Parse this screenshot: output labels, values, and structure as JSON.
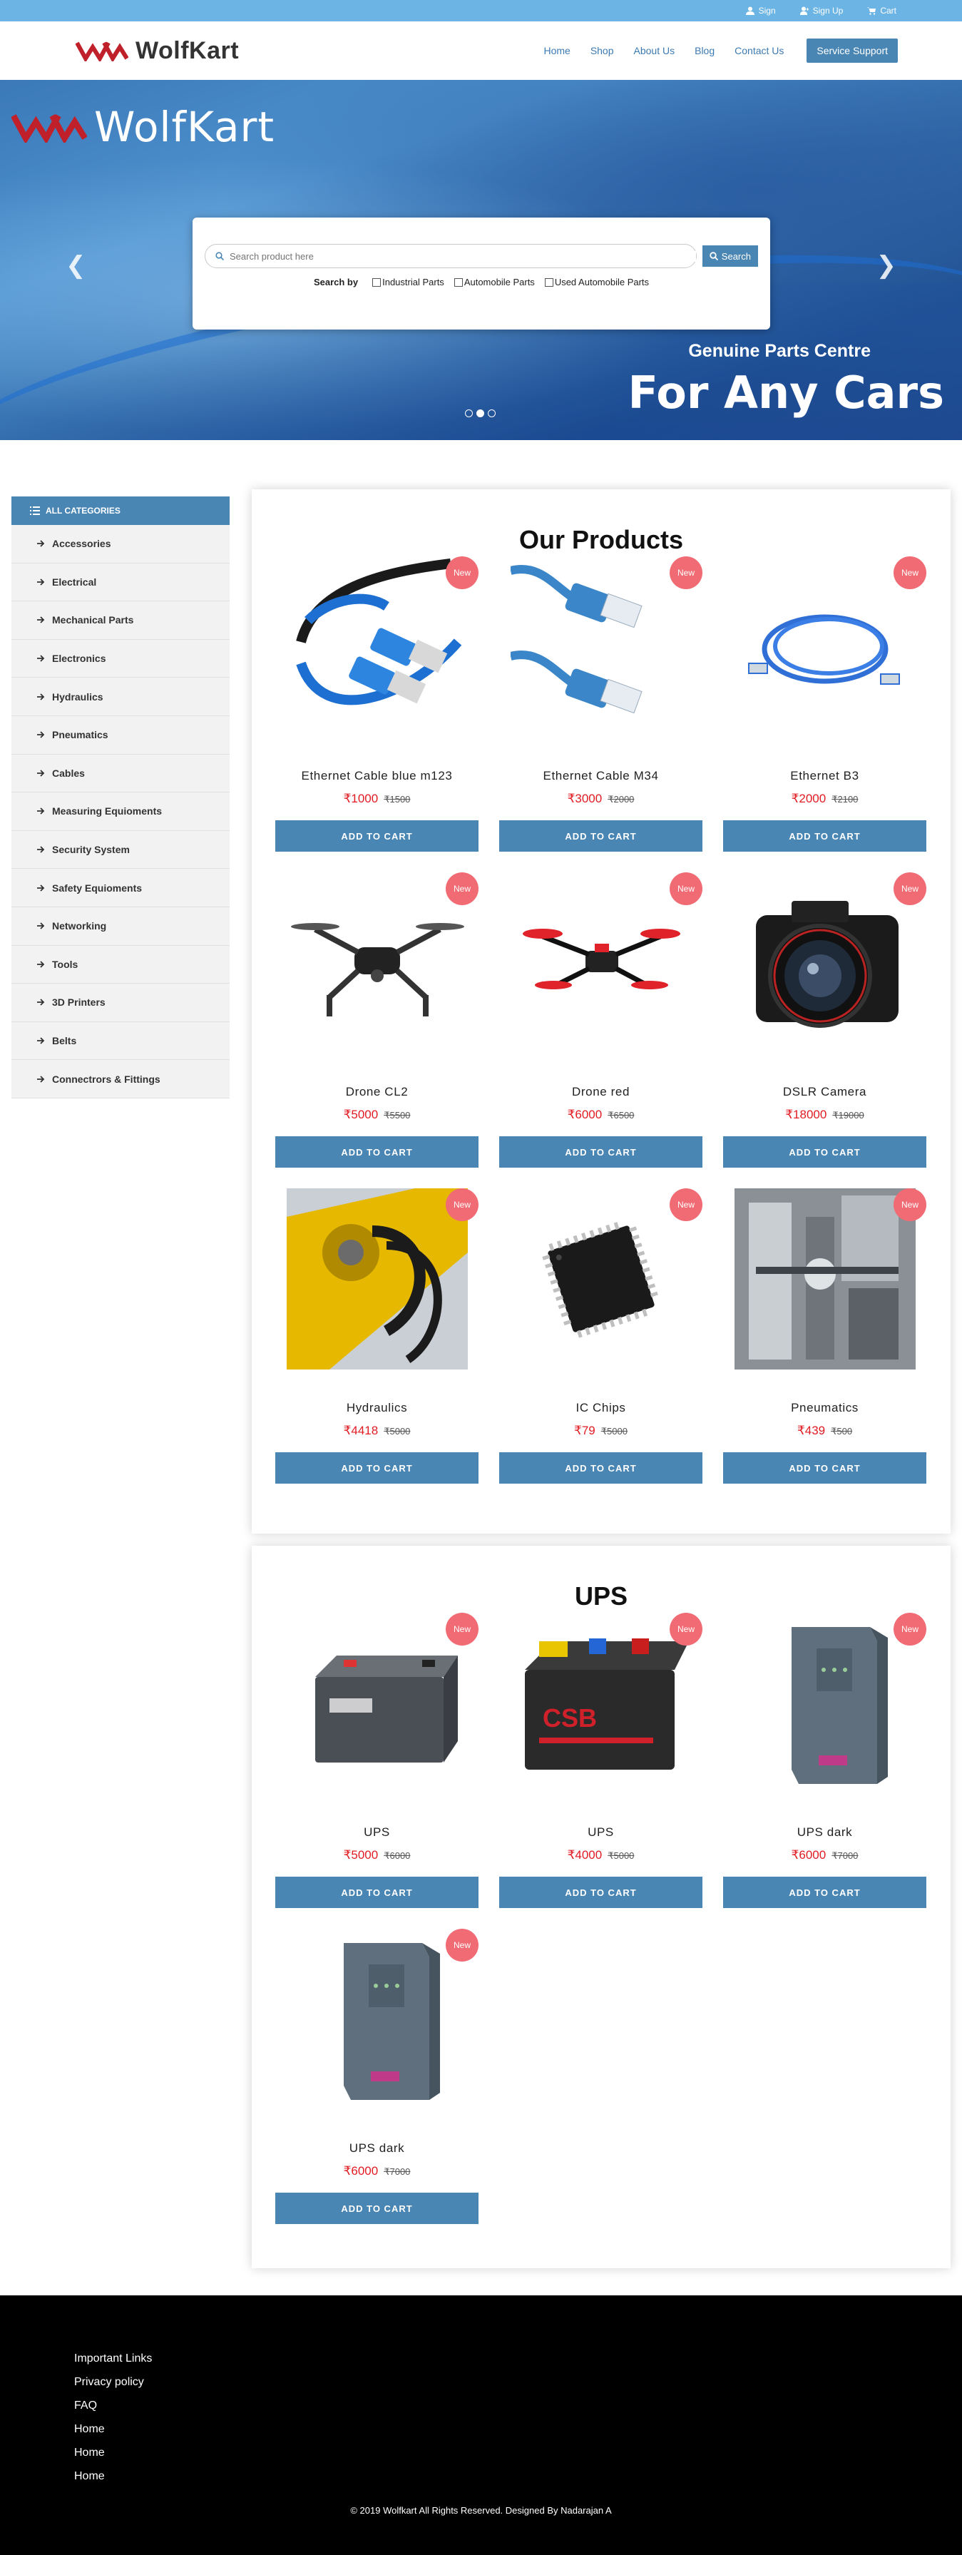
{
  "topbar": {
    "sign": "Sign",
    "signup": "Sign Up",
    "cart": "Cart"
  },
  "brand": {
    "name": "WolfKart",
    "color": "#c0202a"
  },
  "nav": {
    "items": [
      "Home",
      "Shop",
      "About Us",
      "Blog",
      "Contact Us"
    ],
    "support": "Service Support"
  },
  "hero": {
    "search_placeholder": "Search product here",
    "search_button": "Search",
    "search_by": "Search by",
    "filters": [
      "Industrial Parts",
      "Automobile Parts",
      "Used Automobile Parts"
    ],
    "subtitle": "Genuine Parts Centre",
    "title": "For Any Cars",
    "slides": 3,
    "active_slide": 2
  },
  "sidebar": {
    "heading": "ALL CATEGORIES",
    "items": [
      "Accessories",
      "Electrical",
      "Mechanical Parts",
      "Electronics",
      "Hydraulics",
      "Pneumatics",
      "Cables",
      "Measuring Equioments",
      "Security System",
      "Safety Equioments",
      "Networking",
      "Tools",
      "3D Printers",
      "Belts",
      "Connectrors & Fittings"
    ]
  },
  "badge": "New",
  "add_to_cart": "ADD TO CART",
  "products": {
    "title": "Our Products",
    "items": [
      {
        "name": "Ethernet Cable blue m123",
        "price": "₹1000",
        "old_price": "₹1500",
        "icon": "ethernet-cable-icon"
      },
      {
        "name": "Ethernet Cable M34",
        "price": "₹3000",
        "old_price": "₹2000",
        "icon": "ethernet-connector-icon"
      },
      {
        "name": "Ethernet B3",
        "price": "₹2000",
        "old_price": "₹2100",
        "icon": "ethernet-coil-icon"
      },
      {
        "name": "Drone CL2",
        "price": "₹5000",
        "old_price": "₹5500",
        "icon": "drone-icon"
      },
      {
        "name": "Drone red",
        "price": "₹6000",
        "old_price": "₹6500",
        "icon": "drone-red-icon"
      },
      {
        "name": "DSLR Camera",
        "price": "₹18000",
        "old_price": "₹19000",
        "icon": "camera-icon"
      },
      {
        "name": "Hydraulics",
        "price": "₹4418",
        "old_price": "₹5000",
        "icon": "hydraulics-icon"
      },
      {
        "name": "IC Chips",
        "price": "₹79",
        "old_price": "₹5000",
        "icon": "ic-chip-icon"
      },
      {
        "name": "Pneumatics",
        "price": "₹439",
        "old_price": "₹500",
        "icon": "pneumatics-icon"
      }
    ]
  },
  "ups": {
    "title": "UPS",
    "items": [
      {
        "name": "UPS",
        "price": "₹5000",
        "old_price": "₹6000",
        "icon": "battery-icon"
      },
      {
        "name": "UPS",
        "price": "₹4000",
        "old_price": "₹5000",
        "icon": "battery-red-icon"
      },
      {
        "name": "UPS dark",
        "price": "₹6000",
        "old_price": "₹7000",
        "icon": "ups-tower-icon"
      },
      {
        "name": "UPS dark",
        "price": "₹6000",
        "old_price": "₹7000",
        "icon": "ups-tower-icon"
      }
    ]
  },
  "footer": {
    "links": [
      "Important Links",
      "Privacy policy",
      "FAQ",
      "Home",
      "Home",
      "Home"
    ],
    "copyright": "© 2019 Wolfkart All Rights Reserved. Designed By Nadarajan A"
  }
}
